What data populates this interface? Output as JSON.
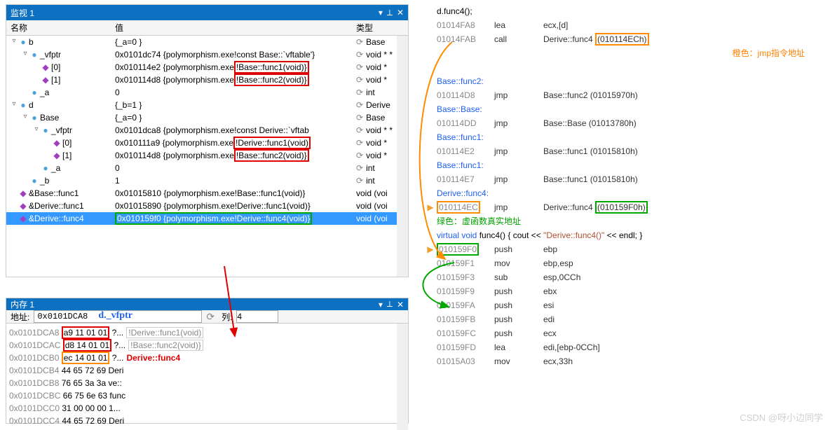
{
  "watch": {
    "title": "监视 1",
    "col_name": "名称",
    "col_value": "值",
    "col_type": "类型",
    "rows": [
      {
        "indent": 0,
        "tw": "▿",
        "glyph": "●",
        "gc": "g-blue",
        "name": "b",
        "val": "{_a=0 }",
        "refresh": true,
        "type": "Base"
      },
      {
        "indent": 1,
        "tw": "▿",
        "glyph": "●",
        "gc": "g-blue",
        "name": "_vfptr",
        "val": "0x0101dc74 {polymorphism.exe!const Base::`vftable'}",
        "refresh": true,
        "type": "void * *"
      },
      {
        "indent": 2,
        "tw": "",
        "glyph": "◆",
        "gc": "g-purple",
        "name": "[0]",
        "val_pre": "0x010114e2 {polymorphism.exe",
        "val_box": "!Base::func1(void)}",
        "box": "red",
        "refresh": true,
        "type": "void *"
      },
      {
        "indent": 2,
        "tw": "",
        "glyph": "◆",
        "gc": "g-purple",
        "name": "[1]",
        "val_pre": "0x010114d8 {polymorphism.exe",
        "val_box": "!Base::func2(void)}",
        "box": "red",
        "refresh": true,
        "type": "void *"
      },
      {
        "indent": 1,
        "tw": "",
        "glyph": "●",
        "gc": "g-field",
        "name": "_a",
        "val": "0",
        "refresh": true,
        "type": "int"
      },
      {
        "indent": 0,
        "tw": "▿",
        "glyph": "●",
        "gc": "g-blue",
        "name": "d",
        "val": "{_b=1 }",
        "refresh": true,
        "type": "Derive"
      },
      {
        "indent": 1,
        "tw": "▿",
        "glyph": "●",
        "gc": "g-blue",
        "name": "Base",
        "val": "{_a=0 }",
        "refresh": true,
        "type": "Base"
      },
      {
        "indent": 2,
        "tw": "▿",
        "glyph": "●",
        "gc": "g-blue",
        "name": "_vfptr",
        "val": "0x0101dca8 {polymorphism.exe!const Derive::`vftab",
        "refresh": true,
        "type": "void * *"
      },
      {
        "indent": 3,
        "tw": "",
        "glyph": "◆",
        "gc": "g-purple",
        "name": "[0]",
        "val_pre": "0x010111a9 {polymorphism.exe",
        "val_box": "!Derive::func1(void)",
        "box": "red",
        "refresh": true,
        "type": "void *"
      },
      {
        "indent": 3,
        "tw": "",
        "glyph": "◆",
        "gc": "g-purple",
        "name": "[1]",
        "val_pre": "0x010114d8 {polymorphism.exe",
        "val_box": "!Base::func2(void)}",
        "box": "red",
        "refresh": true,
        "type": "void *"
      },
      {
        "indent": 2,
        "tw": "",
        "glyph": "●",
        "gc": "g-field",
        "name": "_a",
        "val": "0",
        "refresh": true,
        "type": "int"
      },
      {
        "indent": 1,
        "tw": "",
        "glyph": "●",
        "gc": "g-field",
        "name": "_b",
        "val": "1",
        "refresh": true,
        "type": "int"
      },
      {
        "indent": 0,
        "tw": "",
        "glyph": "◆",
        "gc": "g-purple",
        "name": "&Base::func1",
        "val": "0x01015810 {polymorphism.exe!Base::func1(void)}",
        "refresh": false,
        "type": "void (voi"
      },
      {
        "indent": 0,
        "tw": "",
        "glyph": "◆",
        "gc": "g-purple",
        "name": "&Derive::func1",
        "val": "0x01015890 {polymorphism.exe!Derive::func1(void)}",
        "refresh": false,
        "type": "void (voi"
      },
      {
        "indent": 0,
        "tw": "",
        "glyph": "◆",
        "gc": "g-purple",
        "name": "&Derive::func4",
        "val_pre": "",
        "val_box": "0x010159f0 {polymorphism.exe!Derive::func4(void)}",
        "box": "green",
        "refresh": false,
        "type": "void (voi",
        "sel": true
      }
    ]
  },
  "memory": {
    "title": "内存 1",
    "addr_label": "地址:",
    "addr_value": "0x0101DCA8",
    "addr_hint": "d._vfptr",
    "col_label": "列:",
    "col_value": "4",
    "lines": [
      {
        "addr": "0x0101DCA8",
        "hex": "a9 11 01 01",
        "box": "red",
        "txt": "?...",
        "tip": "!Derive::func1(void)"
      },
      {
        "addr": "0x0101DCAC",
        "hex": "d8 14 01 01",
        "box": "red",
        "txt": "?...",
        "tip": "!Base::func2(void)}"
      },
      {
        "addr": "0x0101DCB0",
        "hex": "ec 14 01 01",
        "box": "orange",
        "txt": "?...",
        "note": "Derive::func4"
      },
      {
        "addr": "0x0101DCB4",
        "hex": "44 65 72 69",
        "txt": "Deri"
      },
      {
        "addr": "0x0101DCB8",
        "hex": "76 65 3a 3a",
        "txt": "ve::"
      },
      {
        "addr": "0x0101DCBC",
        "hex": "66 75 6e 63",
        "txt": "func"
      },
      {
        "addr": "0x0101DCC0",
        "hex": "31 00 00 00",
        "txt": "1..."
      },
      {
        "addr": "0x0101DCC4",
        "hex": "44 65 72 69",
        "txt": "Deri"
      }
    ]
  },
  "asm": {
    "intro": [
      {
        "type": "text",
        "val": "    d.func4();"
      },
      {
        "type": "inst",
        "addr": "01014FA8",
        "op": "lea",
        "arg": "ecx,[d]"
      },
      {
        "type": "inst",
        "addr": "01014FAB",
        "op": "call",
        "arg": "Derive::func4 ",
        "extra_box": "(010114ECh)",
        "box": "orange"
      },
      {
        "type": "note_orange",
        "val": "橙色：jmp指令地址"
      }
    ],
    "jumps": [
      {
        "type": "label",
        "val": "Base::func2:"
      },
      {
        "type": "inst",
        "addr": "010114D8",
        "op": "jmp",
        "arg": "Base::func2 (01015970h)"
      },
      {
        "type": "label",
        "val": "Base::Base:"
      },
      {
        "type": "inst",
        "addr": "010114DD",
        "op": "jmp",
        "arg": "Base::Base (01013780h)"
      },
      {
        "type": "label",
        "val": "Base::func1:"
      },
      {
        "type": "inst",
        "addr": "010114E2",
        "op": "jmp",
        "arg": "Base::func1 (01015810h)"
      },
      {
        "type": "label",
        "val": "Base::func1:"
      },
      {
        "type": "inst",
        "addr": "010114E7",
        "op": "jmp",
        "arg": "Base::func1 (01015810h)"
      },
      {
        "type": "label",
        "val": "Derive::func4:"
      },
      {
        "type": "inst",
        "bp": true,
        "addr_box": "010114EC",
        "box_a": "orange",
        "op": "jmp",
        "arg": "Derive::func4 ",
        "arg_box": "(010159F0h)",
        "box_b": "green"
      }
    ],
    "note_green": "绿色：虚函数真实地址",
    "code_line": {
      "kw": "virtual void",
      "name": " func4() { cout << ",
      "str": "\"Derive::func4()\"",
      "tail": " << endl; }"
    },
    "body": [
      {
        "bp": true,
        "addr": "010159F0",
        "addr_box": "green",
        "op": "push",
        "arg": "ebp"
      },
      {
        "addr": "010159F1",
        "op": "mov",
        "arg": "ebp,esp"
      },
      {
        "addr": "010159F3",
        "op": "sub",
        "arg": "esp,0CCh"
      },
      {
        "addr": "010159F9",
        "op": "push",
        "arg": "ebx"
      },
      {
        "addr": "010159FA",
        "op": "push",
        "arg": "esi"
      },
      {
        "addr": "010159FB",
        "op": "push",
        "arg": "edi"
      },
      {
        "addr": "010159FC",
        "op": "push",
        "arg": "ecx"
      },
      {
        "addr": "010159FD",
        "op": "lea",
        "arg": "edi,[ebp-0CCh]"
      },
      {
        "addr": "01015A03",
        "op": "mov",
        "arg": "ecx,33h"
      }
    ]
  },
  "watermark": "CSDN @呀小边同学"
}
